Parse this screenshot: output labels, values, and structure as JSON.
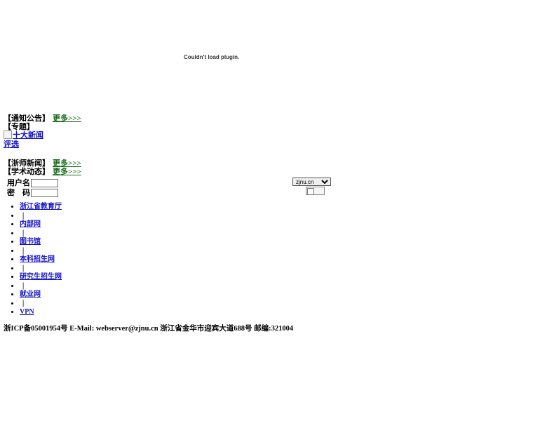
{
  "plugin": {
    "message": "Couldn't load plugin."
  },
  "sections": {
    "notice": {
      "label": "【通知公告】",
      "more": "更多>>>"
    },
    "special": {
      "label": "【专题】",
      "banner_line1": "十大新闻",
      "banner_line2": "评选"
    },
    "news": {
      "label": "【浙师新闻】",
      "more": "更多>>>"
    },
    "academic": {
      "label": "【学术动态】",
      "more": "更多>>>"
    }
  },
  "login": {
    "username_label": "用户名",
    "password_label": "密　码",
    "domain_options": [
      "zjnu.cn"
    ],
    "domain_selected": "zjnu.cn"
  },
  "links": [
    {
      "label": "浙江省教育厅"
    },
    {
      "label": "|"
    },
    {
      "label": "内部网"
    },
    {
      "label": "|"
    },
    {
      "label": "图书馆"
    },
    {
      "label": "|"
    },
    {
      "label": "本科招生网"
    },
    {
      "label": "|"
    },
    {
      "label": "研究生招生网"
    },
    {
      "label": "|"
    },
    {
      "label": "就业网"
    },
    {
      "label": "|"
    },
    {
      "label": "VPN"
    }
  ],
  "footer": {
    "text": "浙ICP备05001954号 E-Mail: webserver@zjnu.cn 浙江省金华市迎宾大道688号 邮编:321004"
  },
  "colors": {
    "link": "#1010c8",
    "more": "#1a6a1a"
  }
}
